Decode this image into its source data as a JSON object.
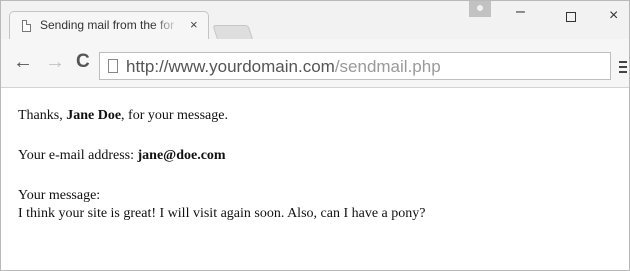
{
  "tab": {
    "title": "Sending mail from the for",
    "close_glyph": "×"
  },
  "window_controls": {
    "minimize": "–",
    "close": "×"
  },
  "nav": {
    "back": "←",
    "forward": "→",
    "reload": "C"
  },
  "address_bar": {
    "host": "http://www.yourdomain.com",
    "path": "/sendmail.php"
  },
  "message": {
    "thanks_prefix": "Thanks, ",
    "name": "Jane Doe",
    "thanks_suffix": ", for your message.",
    "email_label": "Your e-mail address: ",
    "email": "jane@doe.com",
    "message_label": "Your message:",
    "message_text": "I think your site is great! I will visit again soon. Also, can I have a pony?"
  }
}
